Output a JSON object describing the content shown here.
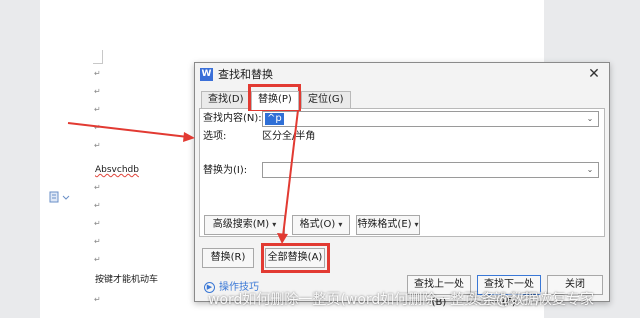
{
  "document": {
    "para_mark": "↵",
    "text_lines": [
      "Absvchdb",
      "按键才能机动车"
    ],
    "side_icon": "document-icon"
  },
  "dialog": {
    "title": "查找和替换",
    "app_icon": "W",
    "close_symbol": "✕",
    "tabs": [
      {
        "label": "查找(D)",
        "active": false
      },
      {
        "label": "替换(P)",
        "active": true
      },
      {
        "label": "定位(G)",
        "active": false
      }
    ],
    "find_label": "查找内容(N):",
    "find_value": "^p",
    "options_label": "选项:",
    "options_value": "区分全/半角",
    "replace_label": "替换为(I):",
    "replace_value": "",
    "dropdown_symbol": "⌄",
    "format_buttons": [
      {
        "label": "高级搜索(M)"
      },
      {
        "label": "格式(O)"
      },
      {
        "label": "特殊格式(E)"
      }
    ],
    "caret_symbol": "▾",
    "replace_button": "替换(R)",
    "replace_all_button": "全部替换(A)",
    "find_prev_button": "查找上一处(B)",
    "find_next_button": "查找下一处(F)",
    "close_button": "关闭",
    "tips_label": "操作技巧",
    "tips_icon": "play-circle-icon"
  },
  "highlight_color": "#e23a32",
  "accent_color": "#3a78d6",
  "watermark": {
    "left": "word如何删除一整页(word如何删除一整页全部内容)",
    "right": "头条@数据恢复专家"
  }
}
